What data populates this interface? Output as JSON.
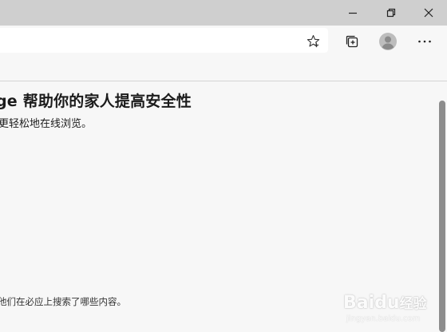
{
  "window": {
    "minimize_icon": "minimize-icon",
    "restore_icon": "restore-icon",
    "close_icon": "close-icon"
  },
  "toolbar": {
    "favorite_icon": "star-outline-icon",
    "collections_icon": "collections-icon",
    "profile_icon": "person-avatar-icon",
    "menu_icon": "more-horizontal-icon"
  },
  "page": {
    "heading": "ge 帮助你的家人提高安全性",
    "subtext": "更轻松地在线浏览。",
    "bottom_text": "他们在必应上搜索了哪些内容。"
  },
  "watermark": {
    "logo": "Baidu",
    "sub": "jingyan.baidu.com",
    "suffix": "经验"
  },
  "colors": {
    "titlebar": "#cfcfcf",
    "background": "#f7f7f7",
    "addressbar": "#ffffff",
    "scrollthumb": "#8d8d8d"
  }
}
